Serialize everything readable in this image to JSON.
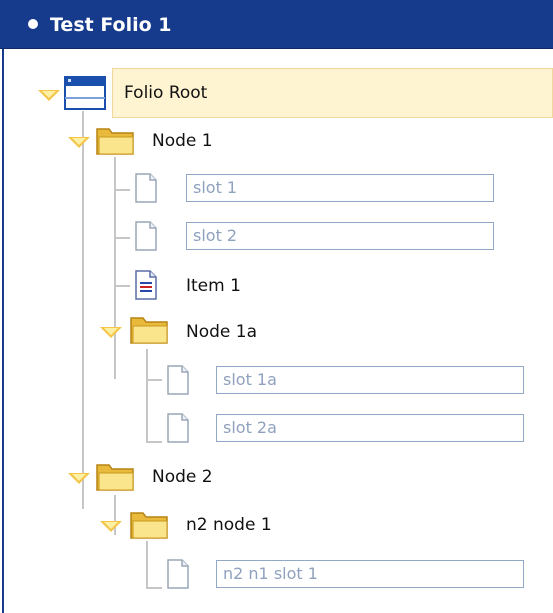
{
  "window": {
    "title": "Test Folio 1"
  },
  "tree": {
    "root_label": "Folio Root",
    "node1": {
      "label": "Node 1",
      "slot1_value": "slot 1",
      "slot2_value": "slot 2",
      "item1_label": "Item 1",
      "node1a": {
        "label": "Node 1a",
        "slot1a_value": "slot 1a",
        "slot2a_value": "slot 2a"
      }
    },
    "node2": {
      "label": "Node 2",
      "n2node1": {
        "label": "n2 node 1",
        "slot_value": "n2 n1 slot 1"
      }
    }
  },
  "colors": {
    "titlebar": "#163a8c",
    "root_highlight": "#fff4d2",
    "folder_yellow": "#f3c64a",
    "input_text": "#8fa1be"
  },
  "icons": [
    "expand-arrow-icon",
    "folio-root-icon",
    "folder-icon",
    "blank-page-icon",
    "document-icon"
  ]
}
